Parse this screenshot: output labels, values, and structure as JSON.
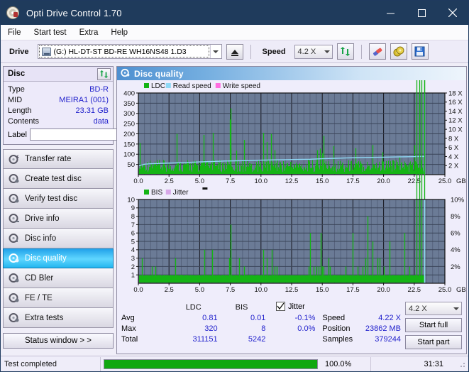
{
  "window": {
    "title": "Opti Drive Control 1.70",
    "icon": "disc-icon",
    "minimize": "minimize-icon",
    "maximize": "maximize-icon",
    "close": "close-icon"
  },
  "menu": {
    "items": [
      "File",
      "Start test",
      "Extra",
      "Help"
    ]
  },
  "toolbar": {
    "drive_label": "Drive",
    "drive_value": "(G:)  HL-DT-ST BD-RE  WH16NS48 1.D3",
    "eject": "eject-icon",
    "speed_label": "Speed",
    "speed_value": "4.2 X",
    "refresh": "refresh-icon",
    "eraser": "eraser-icon",
    "disc": "gold-disc-icon",
    "save": "save-icon"
  },
  "disc_panel": {
    "title": "Disc",
    "refresh": "refresh-icon",
    "rows": [
      {
        "key": "Type",
        "value": "BD-R"
      },
      {
        "key": "MID",
        "value": "MEIRA1 (001)"
      },
      {
        "key": "Length",
        "value": "23.31 GB"
      },
      {
        "key": "Contents",
        "value": "data"
      }
    ],
    "label_key": "Label",
    "label_value": "",
    "label_button": "disc-label-icon"
  },
  "nav": {
    "items": [
      {
        "label": "Transfer rate",
        "icon": "disc-test-icon",
        "active": false
      },
      {
        "label": "Create test disc",
        "icon": "disc-test-icon",
        "active": false
      },
      {
        "label": "Verify test disc",
        "icon": "disc-test-icon",
        "active": false
      },
      {
        "label": "Drive info",
        "icon": "disc-test-icon",
        "active": false
      },
      {
        "label": "Disc info",
        "icon": "disc-test-icon",
        "active": false
      },
      {
        "label": "Disc quality",
        "icon": "disc-test-icon",
        "active": true
      },
      {
        "label": "CD Bler",
        "icon": "disc-test-icon",
        "active": false
      },
      {
        "label": "FE / TE",
        "icon": "disc-test-icon",
        "active": false
      },
      {
        "label": "Extra tests",
        "icon": "disc-test-icon",
        "active": false
      }
    ],
    "status_window": "Status window > >"
  },
  "main": {
    "title": "Disc quality",
    "icon": "disc-quality-icon"
  },
  "stats": {
    "col_headers": [
      "LDC",
      "BIS"
    ],
    "rows": [
      {
        "name": "Avg",
        "ldc": "0.81",
        "bis": "0.01",
        "jitter": "-0.1%"
      },
      {
        "name": "Max",
        "ldc": "320",
        "bis": "8",
        "jitter": "0.0%"
      },
      {
        "name": "Total",
        "ldc": "311151",
        "bis": "5242",
        "jitter": ""
      }
    ],
    "jitter_label": "Jitter",
    "jitter_checked": true,
    "speed_label": "Speed",
    "speed_value": "4.22 X",
    "position_label": "Position",
    "position_value": "23862 MB",
    "samples_label": "Samples",
    "samples_value": "379244",
    "speed_select": "4.2 X",
    "start_full": "Start full",
    "start_part": "Start part"
  },
  "statusbar": {
    "text": "Test completed",
    "percent": "100.0%",
    "progress": 100,
    "time": "31:31"
  },
  "colors": {
    "ldc_green": "#15b415",
    "read_speed": "#8fd8f5",
    "write_speed": "#ff6ee0",
    "bis_green": "#15b415",
    "jitter": "#d8a8e8",
    "plot_bg": "#6b7b96",
    "accent": "#2222cc"
  },
  "chart_data": [
    {
      "type": "line",
      "title": "LDC / Read speed",
      "xlabel": "GB",
      "ylabel": "LDC",
      "xlim": [
        0,
        25.0
      ],
      "ylim": [
        0,
        400
      ],
      "y2lim": [
        0,
        18
      ],
      "y2label": "X",
      "grid": true,
      "legend": [
        "LDC",
        "Read speed",
        "Write speed"
      ],
      "legend_position": "top-left",
      "xticks": [
        0.0,
        2.5,
        5.0,
        7.5,
        10.0,
        12.5,
        15.0,
        17.5,
        20.0,
        22.5,
        25.0
      ],
      "yticks": [
        0,
        50,
        100,
        150,
        200,
        250,
        300,
        350,
        400
      ],
      "y2ticks": [
        2,
        4,
        6,
        8,
        10,
        12,
        14,
        16,
        18
      ],
      "series": [
        {
          "name": "LDC",
          "kind": "impulse",
          "color": "#15b415",
          "x": [
            0.05,
            0.12,
            0.2,
            0.28,
            0.35,
            0.42,
            0.5,
            0.58,
            0.65,
            0.72,
            0.8,
            0.9,
            1.0,
            1.1,
            1.2,
            1.3,
            1.4,
            1.5,
            1.6,
            1.7,
            1.8,
            1.9,
            2.0,
            2.1,
            2.2,
            2.3,
            2.4,
            2.5,
            2.6,
            2.7,
            2.8,
            2.9,
            3.0,
            3.1,
            3.2,
            3.3,
            3.4,
            3.5,
            3.6,
            3.7,
            3.8,
            3.9,
            4.0,
            4.2,
            4.4,
            4.6,
            4.8,
            5.0,
            5.2,
            5.35,
            5.45,
            5.6,
            5.8,
            6.0,
            6.1,
            6.2,
            6.4,
            6.6,
            6.8,
            7.0,
            7.2,
            7.4,
            7.45,
            7.5,
            7.55,
            7.6,
            7.7,
            7.8,
            8.0,
            8.2,
            8.4,
            8.6,
            8.8,
            9.0,
            9.2,
            9.4,
            9.6,
            9.8,
            10.0,
            10.2,
            10.35,
            10.45,
            10.6,
            10.8,
            11.0,
            11.1,
            11.2,
            11.4,
            11.6,
            11.8,
            12.0,
            12.2,
            12.4,
            12.6,
            12.8,
            13.0,
            13.2,
            13.4,
            13.6,
            13.8,
            14.0,
            14.2,
            14.4,
            14.6,
            14.8,
            14.9,
            15.0,
            15.1,
            15.3,
            15.5,
            15.7,
            15.9,
            16.0,
            16.1,
            16.3,
            16.5,
            16.7,
            16.9,
            17.1,
            17.3,
            17.5,
            17.7,
            17.9,
            18.1,
            18.3,
            18.5,
            18.7,
            18.9,
            19.1,
            19.3,
            19.5,
            19.7,
            19.9,
            20.0,
            20.1,
            20.3,
            20.5,
            20.7,
            20.9,
            21.1,
            21.3,
            21.5,
            21.7,
            21.9,
            22.1,
            22.3,
            22.5,
            22.6,
            22.7,
            22.9,
            23.1,
            23.3
          ],
          "y": [
            30,
            155,
            28,
            18,
            22,
            16,
            30,
            18,
            24,
            14,
            18,
            22,
            16,
            28,
            18,
            14,
            20,
            45,
            22,
            16,
            18,
            14,
            22,
            16,
            20,
            14,
            18,
            26,
            16,
            22,
            18,
            30,
            14,
            200,
            22,
            18,
            16,
            26,
            14,
            20,
            18,
            14,
            22,
            18,
            16,
            40,
            18,
            22,
            16,
            195,
            28,
            18,
            22,
            16,
            205,
            34,
            18,
            22,
            16,
            20,
            28,
            50,
            270,
            325,
            130,
            40,
            22,
            18,
            118,
            16,
            22,
            170,
            18,
            22,
            16,
            20,
            14,
            18,
            26,
            205,
            30,
            160,
            22,
            200,
            38,
            120,
            26,
            18,
            22,
            16,
            20,
            14,
            18,
            22,
            16,
            20,
            26,
            18,
            22,
            16,
            30,
            22,
            18,
            120,
            128,
            22,
            105,
            190,
            28,
            18,
            22,
            140,
            16,
            20,
            14,
            18,
            22,
            16,
            20,
            26,
            18,
            130,
            22,
            16,
            20,
            14,
            18,
            22,
            145,
            30,
            18,
            22,
            110,
            16,
            20,
            14,
            18,
            22,
            16,
            20,
            85,
            18,
            22,
            16,
            20,
            14,
            145,
            60,
            18,
            22,
            16
          ]
        },
        {
          "name": "Read speed",
          "kind": "line",
          "color": "#8fd8f5",
          "axis": "y2",
          "x": [
            0.05,
            0.5,
            1.0,
            2.0,
            3.0,
            4.0,
            5.0,
            6.0,
            7.0,
            8.0,
            9.0,
            10.0,
            11.0,
            12.0,
            13.0,
            14.0,
            15.0,
            16.0,
            17.0,
            18.0,
            19.0,
            20.0,
            21.0,
            22.0,
            23.0,
            23.35
          ],
          "y": [
            2.0,
            2.3,
            2.4,
            2.5,
            2.6,
            2.7,
            2.8,
            2.9,
            3.0,
            3.05,
            3.1,
            3.2,
            3.25,
            3.3,
            3.35,
            3.4,
            3.5,
            3.6,
            3.7,
            3.75,
            3.8,
            3.85,
            3.9,
            3.95,
            4.0,
            4.0
          ]
        },
        {
          "name": "Write speed",
          "kind": "line",
          "color": "#ff6ee0",
          "x": [],
          "y": []
        }
      ],
      "cursor_x": 23.35
    },
    {
      "type": "line",
      "title": "BIS / Jitter",
      "xlabel": "GB",
      "ylabel": "BIS",
      "xlim": [
        0,
        25.0
      ],
      "ylim": [
        0,
        10
      ],
      "y2lim": [
        0,
        10
      ],
      "y2label": "%",
      "grid": true,
      "legend": [
        "BIS",
        "Jitter"
      ],
      "legend_position": "top-left",
      "xticks": [
        0.0,
        2.5,
        5.0,
        7.5,
        10.0,
        12.5,
        15.0,
        17.5,
        20.0,
        22.5,
        25.0
      ],
      "yticks": [
        1,
        2,
        3,
        4,
        5,
        6,
        7,
        8,
        9,
        10
      ],
      "y2ticks": [
        "2%",
        "4%",
        "6%",
        "8%",
        "10%"
      ],
      "series": [
        {
          "name": "BIS",
          "kind": "impulse",
          "color": "#15b415",
          "x": [
            0.1,
            0.3,
            0.5,
            0.7,
            0.9,
            1.1,
            1.25,
            1.4,
            1.6,
            1.8,
            2.0,
            2.2,
            2.4,
            2.6,
            2.8,
            3.0,
            3.2,
            3.4,
            3.5,
            3.6,
            3.8,
            4.0,
            4.2,
            4.4,
            4.6,
            4.8,
            5.0,
            5.2,
            5.4,
            5.5,
            5.6,
            5.8,
            6.0,
            6.1,
            6.2,
            6.4,
            6.6,
            6.8,
            7.0,
            7.2,
            7.4,
            7.5,
            7.55,
            7.6,
            7.8,
            8.0,
            8.2,
            8.4,
            8.6,
            8.8,
            8.9,
            9.0,
            9.2,
            9.4,
            9.6,
            9.8,
            10.0,
            10.2,
            10.35,
            10.5,
            10.7,
            10.9,
            11.0,
            11.1,
            11.3,
            11.5,
            11.7,
            11.9,
            12.1,
            12.3,
            12.5,
            12.7,
            12.9,
            13.1,
            13.3,
            13.5,
            13.7,
            13.9,
            14.0,
            14.1,
            14.3,
            14.5,
            14.7,
            14.9,
            15.0,
            15.1,
            15.3,
            15.5,
            15.6,
            15.7,
            15.9,
            16.0,
            16.1,
            16.3,
            16.5,
            16.7,
            16.9,
            17.1,
            17.3,
            17.5,
            17.7,
            17.9,
            18.1,
            18.3,
            18.5,
            18.7,
            18.9,
            19.1,
            19.3,
            19.5,
            19.7,
            19.9,
            20.0,
            20.1,
            20.3,
            20.5,
            20.7,
            20.9,
            21.1,
            21.3,
            21.5,
            21.7,
            21.9,
            22.1,
            22.3,
            22.5,
            22.6,
            22.7,
            22.9,
            23.1,
            23.3
          ],
          "y": [
            1,
            3,
            1,
            1,
            1,
            2,
            1,
            2,
            1,
            1,
            1,
            1,
            1,
            1,
            1,
            3,
            1,
            1,
            1,
            1,
            1,
            1,
            1,
            1,
            1,
            1,
            1,
            1,
            4,
            1,
            1,
            1,
            4,
            1,
            1,
            1,
            1,
            1,
            1,
            1,
            3,
            7,
            3,
            1,
            1,
            1,
            3,
            1,
            2,
            1,
            1,
            1,
            1,
            1,
            1,
            1,
            1,
            4,
            1,
            3,
            1,
            4,
            1,
            2,
            2,
            1,
            1,
            1,
            1,
            1,
            1,
            1,
            1,
            1,
            1,
            1,
            1,
            2,
            6,
            1,
            2,
            2,
            2,
            6,
            2,
            2,
            1,
            3,
            2,
            1,
            1,
            1,
            1,
            1,
            1,
            1,
            2,
            1,
            1,
            6,
            1,
            2,
            1,
            2,
            3,
            8,
            1,
            5,
            1,
            3,
            3,
            1,
            2,
            1,
            1,
            5,
            1,
            1,
            1,
            1,
            1,
            6,
            1,
            2,
            1,
            1,
            1
          ]
        },
        {
          "name": "Jitter",
          "kind": "line",
          "color": "#d8a8e8",
          "axis": "y2",
          "x": [],
          "y": []
        }
      ],
      "cursor_x": 23.35
    }
  ]
}
